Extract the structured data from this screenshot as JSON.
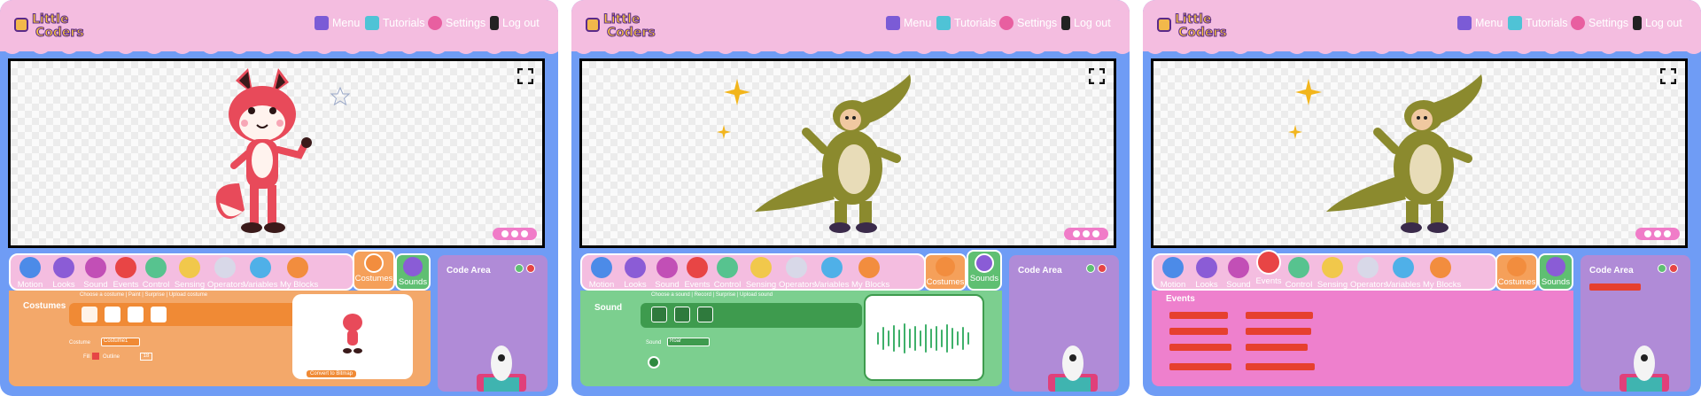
{
  "app": {
    "logo_line1": "Little",
    "logo_line2": "Coders"
  },
  "nav": {
    "menu": "Menu",
    "tutorials": "Tutorials",
    "settings": "Settings",
    "logout": "Log out"
  },
  "categories": [
    "Motion",
    "Looks",
    "Sound",
    "Events",
    "Control",
    "Sensing",
    "Operators",
    "Variables",
    "My Blocks"
  ],
  "tabs": {
    "costumes": "Costumes",
    "sounds": "Sounds"
  },
  "code_area": {
    "title": "Code Area"
  },
  "panel1": {
    "section_title": "Costumes",
    "toolbar_text": "Choose a costume | Paint | Surprise | Upload costume",
    "costume_label": "Costume",
    "costume_value": "Costume1",
    "fill_label": "Fill",
    "outline_label": "Outline",
    "size_value": "18",
    "convert_button": "Convert to Bitmap"
  },
  "panel2": {
    "section_title": "Sound",
    "toolbar_text": "Choose a sound | Record | Surprise | Upload sound",
    "sound_label": "Sound",
    "sound_value": "Roar"
  },
  "panel3": {
    "section_title": "Events"
  },
  "colors": {
    "header": "#f4bde0",
    "background": "#6f9cf5",
    "costumes_accent": "#f5a05a",
    "sound_accent": "#5fbf72",
    "events_accent": "#ee80cd",
    "block_red": "#e6402e",
    "code_area": "#b08bd7"
  },
  "icons": [
    "menu-icon",
    "tutorials-icon",
    "settings-icon",
    "logout-icon",
    "fullscreen-icon",
    "play-icon"
  ]
}
